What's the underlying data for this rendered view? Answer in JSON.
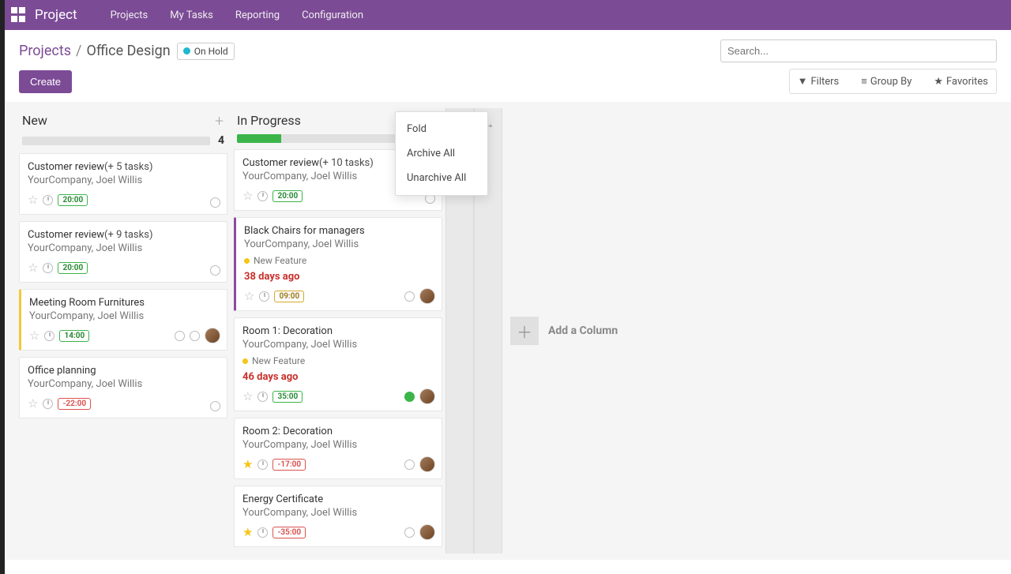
{
  "topbar": {
    "brand": "Project",
    "menu": [
      "Projects",
      "My Tasks",
      "Reporting",
      "Configuration"
    ]
  },
  "breadcrumb": {
    "parent": "Projects",
    "current": "Office Design"
  },
  "status_tag": "On Hold",
  "search_placeholder": "Search...",
  "buttons": {
    "create": "Create",
    "filters": "Filters",
    "group_by": "Group By",
    "favorites": "Favorites",
    "add_column": "Add a Column"
  },
  "dropdown": {
    "fold": "Fold",
    "archive_all": "Archive All",
    "unarchive_all": "Unarchive All"
  },
  "columns": {
    "new": {
      "title": "New",
      "count": "4",
      "progress_pct": 0,
      "cards": [
        {
          "title": "Customer review",
          "subtasks": "(+ 5 tasks)",
          "sub": "YourCompany, Joel Willis",
          "time": "20:00",
          "time_class": "",
          "star": false,
          "avatar": false,
          "border": ""
        },
        {
          "title": "Customer review",
          "subtasks": "(+ 9 tasks)",
          "sub": "YourCompany, Joel Willis",
          "time": "20:00",
          "time_class": "",
          "star": false,
          "avatar": false,
          "border": ""
        },
        {
          "title": "Meeting Room Furnitures",
          "subtasks": "",
          "sub": "YourCompany, Joel Willis",
          "time": "14:00",
          "time_class": "",
          "star": false,
          "avatar": true,
          "border": "border-yellow"
        },
        {
          "title": "Office planning",
          "subtasks": "",
          "sub": "YourCompany, Joel Willis",
          "time": "-22:00",
          "time_class": "neg",
          "star": false,
          "avatar": false,
          "border": ""
        }
      ]
    },
    "in_progress": {
      "title": "In Progress",
      "progress_pct": 22,
      "cards": [
        {
          "title": "Customer review",
          "subtasks": "(+ 10 tasks)",
          "sub": "YourCompany, Joel Willis",
          "time": "20:00",
          "time_class": "",
          "star": false,
          "feature": "",
          "overdue": "",
          "avatar": false,
          "ring_green": false,
          "border": ""
        },
        {
          "title": "Black Chairs for managers",
          "subtasks": "",
          "sub": "YourCompany, Joel Willis",
          "time": "09:00",
          "time_class": "yellow",
          "star": false,
          "feature": "New Feature",
          "overdue": "38 days ago",
          "avatar": true,
          "ring_green": false,
          "border": "border-purple"
        },
        {
          "title": "Room 1: Decoration",
          "subtasks": "",
          "sub": "YourCompany, Joel Willis",
          "time": "35:00",
          "time_class": "",
          "star": false,
          "feature": "New Feature",
          "overdue": "46 days ago",
          "avatar": true,
          "ring_green": true,
          "border": ""
        },
        {
          "title": "Room 2: Decoration",
          "subtasks": "",
          "sub": "YourCompany, Joel Willis",
          "time": "-17:00",
          "time_class": "neg",
          "star": true,
          "feature": "",
          "overdue": "",
          "avatar": true,
          "ring_green": false,
          "border": ""
        },
        {
          "title": "Energy Certificate",
          "subtasks": "",
          "sub": "YourCompany, Joel Willis",
          "time": "-35:00",
          "time_class": "neg",
          "star": true,
          "feature": "",
          "overdue": "",
          "avatar": true,
          "ring_green": false,
          "border": ""
        }
      ]
    }
  }
}
